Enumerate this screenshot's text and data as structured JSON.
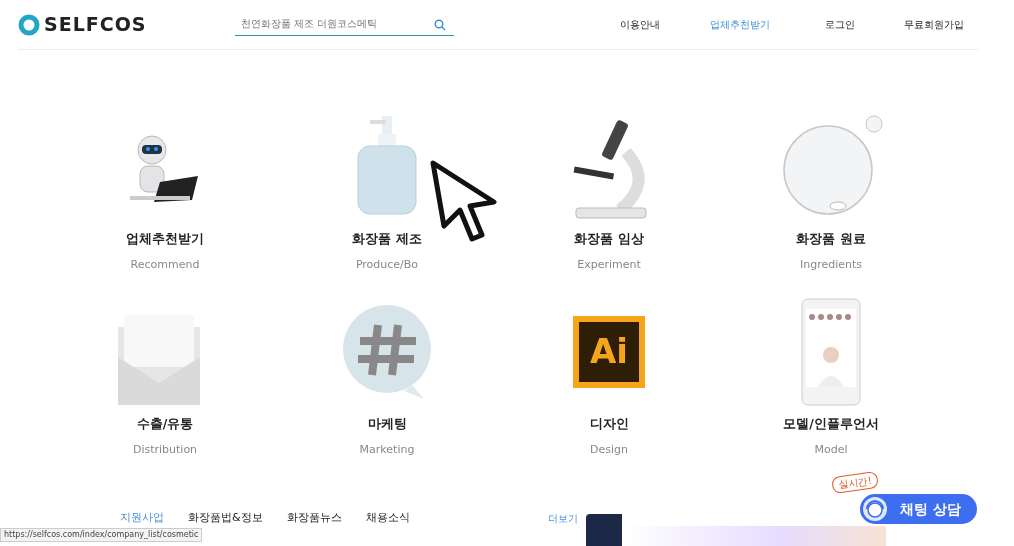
{
  "header": {
    "logo": "SELFCOS",
    "search": {
      "placeholder": "천연화장품 제조 더원코스메틱"
    },
    "nav": [
      {
        "label": "이용안내",
        "selected": false
      },
      {
        "label": "업체추천받기",
        "selected": true
      },
      {
        "label": "로그인",
        "selected": false
      },
      {
        "label": "무료회원가입",
        "selected": false
      }
    ]
  },
  "categories": [
    {
      "title": "업체추천받기",
      "subtitle": "Recommend",
      "kind": "robot"
    },
    {
      "title": "화장품 제조",
      "subtitle": "Produce/Bo",
      "kind": "bottle"
    },
    {
      "title": "화장품 임상",
      "subtitle": "Experiment",
      "kind": "microscope"
    },
    {
      "title": "화장품 원료",
      "subtitle": "Ingredients",
      "kind": "bubble"
    },
    {
      "title": "수출/유통",
      "subtitle": "Distribution",
      "kind": "envelope"
    },
    {
      "title": "마케팅",
      "subtitle": "Marketing",
      "kind": "hashtag"
    },
    {
      "title": "디자인",
      "subtitle": "Design",
      "kind": "ai",
      "icon_text": "Ai"
    },
    {
      "title": "모델/인플루언서",
      "subtitle": "Model",
      "kind": "phone"
    }
  ],
  "news_tabs": [
    {
      "label": "지원사업",
      "selected": true
    },
    {
      "label": "화장품법&정보",
      "selected": false
    },
    {
      "label": "화장품뉴스",
      "selected": false
    },
    {
      "label": "채용소식",
      "selected": false
    }
  ],
  "more_link": "더보기",
  "chat": {
    "badge": "실시간!",
    "label": "채팅 상담"
  },
  "status_url": "https://selfcos.com/index/company_list/cosmetic"
}
